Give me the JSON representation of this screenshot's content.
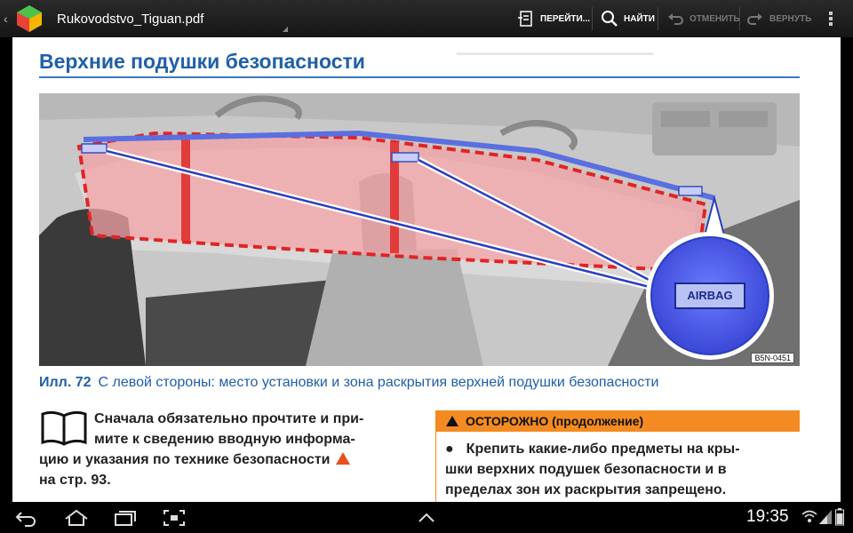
{
  "actionbar": {
    "title": "Rukovodstvo_Tiguan.pdf",
    "goto_label": "ПЕРЕЙТИ...",
    "find_label": "НАЙТИ",
    "undo_label": "ОТМЕНИТЬ",
    "redo_label": "ВЕРНУТЬ",
    "icons": [
      "app-icon",
      "goto-icon",
      "search-icon",
      "undo-icon",
      "redo-icon",
      "overflow-menu-icon"
    ]
  },
  "document": {
    "heading": "Верхние подушки безопасности",
    "figure_badge": "AIRBAG",
    "figure_code": "B5N-0451",
    "caption_label": "Илл. 72",
    "caption_text": "С левой стороны: место установки и зона раскрытия верхней подушки безопасности",
    "intro_text_line1": "Сначала обязательно прочтите и при-",
    "intro_text_line2": "мите к сведению вводную информа-",
    "intro_text_line3": "цию и указания по технике безопасности",
    "intro_text_line4": "на стр. 93.",
    "warning_title": "ОСТОРОЖНО (продолжение)",
    "warning_bullet": "●",
    "warning_line1": "Крепить какие-либо предметы на кры-",
    "warning_line2": "шки верхних подушек безопасности и в",
    "warning_line3": "пределах зон их раскрытия запрещено."
  },
  "statusbar": {
    "time": "19:35",
    "icons": [
      "back-icon",
      "home-icon",
      "recent-apps-icon",
      "screenshot-icon",
      "up-chevron-icon",
      "wifi-icon",
      "signal-icon",
      "battery-icon"
    ]
  },
  "colors": {
    "accent": "#1f5fa8",
    "warning": "#f38b22",
    "airbag_zone": "#f4a3a6"
  }
}
